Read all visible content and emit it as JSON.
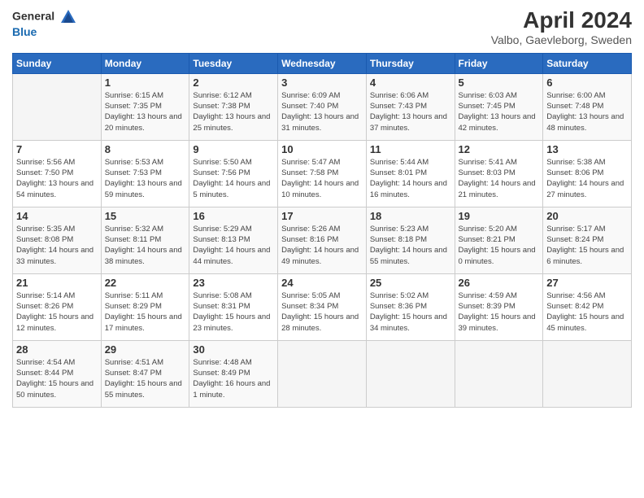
{
  "header": {
    "logo_line1": "General",
    "logo_line2": "Blue",
    "month": "April 2024",
    "location": "Valbo, Gaevleborg, Sweden"
  },
  "weekdays": [
    "Sunday",
    "Monday",
    "Tuesday",
    "Wednesday",
    "Thursday",
    "Friday",
    "Saturday"
  ],
  "weeks": [
    [
      {
        "day": "",
        "sunrise": "",
        "sunset": "",
        "daylight": ""
      },
      {
        "day": "1",
        "sunrise": "6:15 AM",
        "sunset": "7:35 PM",
        "daylight": "13 hours and 20 minutes."
      },
      {
        "day": "2",
        "sunrise": "6:12 AM",
        "sunset": "7:38 PM",
        "daylight": "13 hours and 25 minutes."
      },
      {
        "day": "3",
        "sunrise": "6:09 AM",
        "sunset": "7:40 PM",
        "daylight": "13 hours and 31 minutes."
      },
      {
        "day": "4",
        "sunrise": "6:06 AM",
        "sunset": "7:43 PM",
        "daylight": "13 hours and 37 minutes."
      },
      {
        "day": "5",
        "sunrise": "6:03 AM",
        "sunset": "7:45 PM",
        "daylight": "13 hours and 42 minutes."
      },
      {
        "day": "6",
        "sunrise": "6:00 AM",
        "sunset": "7:48 PM",
        "daylight": "13 hours and 48 minutes."
      }
    ],
    [
      {
        "day": "7",
        "sunrise": "5:56 AM",
        "sunset": "7:50 PM",
        "daylight": "13 hours and 54 minutes."
      },
      {
        "day": "8",
        "sunrise": "5:53 AM",
        "sunset": "7:53 PM",
        "daylight": "13 hours and 59 minutes."
      },
      {
        "day": "9",
        "sunrise": "5:50 AM",
        "sunset": "7:56 PM",
        "daylight": "14 hours and 5 minutes."
      },
      {
        "day": "10",
        "sunrise": "5:47 AM",
        "sunset": "7:58 PM",
        "daylight": "14 hours and 10 minutes."
      },
      {
        "day": "11",
        "sunrise": "5:44 AM",
        "sunset": "8:01 PM",
        "daylight": "14 hours and 16 minutes."
      },
      {
        "day": "12",
        "sunrise": "5:41 AM",
        "sunset": "8:03 PM",
        "daylight": "14 hours and 21 minutes."
      },
      {
        "day": "13",
        "sunrise": "5:38 AM",
        "sunset": "8:06 PM",
        "daylight": "14 hours and 27 minutes."
      }
    ],
    [
      {
        "day": "14",
        "sunrise": "5:35 AM",
        "sunset": "8:08 PM",
        "daylight": "14 hours and 33 minutes."
      },
      {
        "day": "15",
        "sunrise": "5:32 AM",
        "sunset": "8:11 PM",
        "daylight": "14 hours and 38 minutes."
      },
      {
        "day": "16",
        "sunrise": "5:29 AM",
        "sunset": "8:13 PM",
        "daylight": "14 hours and 44 minutes."
      },
      {
        "day": "17",
        "sunrise": "5:26 AM",
        "sunset": "8:16 PM",
        "daylight": "14 hours and 49 minutes."
      },
      {
        "day": "18",
        "sunrise": "5:23 AM",
        "sunset": "8:18 PM",
        "daylight": "14 hours and 55 minutes."
      },
      {
        "day": "19",
        "sunrise": "5:20 AM",
        "sunset": "8:21 PM",
        "daylight": "15 hours and 0 minutes."
      },
      {
        "day": "20",
        "sunrise": "5:17 AM",
        "sunset": "8:24 PM",
        "daylight": "15 hours and 6 minutes."
      }
    ],
    [
      {
        "day": "21",
        "sunrise": "5:14 AM",
        "sunset": "8:26 PM",
        "daylight": "15 hours and 12 minutes."
      },
      {
        "day": "22",
        "sunrise": "5:11 AM",
        "sunset": "8:29 PM",
        "daylight": "15 hours and 17 minutes."
      },
      {
        "day": "23",
        "sunrise": "5:08 AM",
        "sunset": "8:31 PM",
        "daylight": "15 hours and 23 minutes."
      },
      {
        "day": "24",
        "sunrise": "5:05 AM",
        "sunset": "8:34 PM",
        "daylight": "15 hours and 28 minutes."
      },
      {
        "day": "25",
        "sunrise": "5:02 AM",
        "sunset": "8:36 PM",
        "daylight": "15 hours and 34 minutes."
      },
      {
        "day": "26",
        "sunrise": "4:59 AM",
        "sunset": "8:39 PM",
        "daylight": "15 hours and 39 minutes."
      },
      {
        "day": "27",
        "sunrise": "4:56 AM",
        "sunset": "8:42 PM",
        "daylight": "15 hours and 45 minutes."
      }
    ],
    [
      {
        "day": "28",
        "sunrise": "4:54 AM",
        "sunset": "8:44 PM",
        "daylight": "15 hours and 50 minutes."
      },
      {
        "day": "29",
        "sunrise": "4:51 AM",
        "sunset": "8:47 PM",
        "daylight": "15 hours and 55 minutes."
      },
      {
        "day": "30",
        "sunrise": "4:48 AM",
        "sunset": "8:49 PM",
        "daylight": "16 hours and 1 minute."
      },
      {
        "day": "",
        "sunrise": "",
        "sunset": "",
        "daylight": ""
      },
      {
        "day": "",
        "sunrise": "",
        "sunset": "",
        "daylight": ""
      },
      {
        "day": "",
        "sunrise": "",
        "sunset": "",
        "daylight": ""
      },
      {
        "day": "",
        "sunrise": "",
        "sunset": "",
        "daylight": ""
      }
    ]
  ],
  "labels": {
    "sunrise_prefix": "Sunrise: ",
    "sunset_prefix": "Sunset: ",
    "daylight_prefix": "Daylight: "
  }
}
